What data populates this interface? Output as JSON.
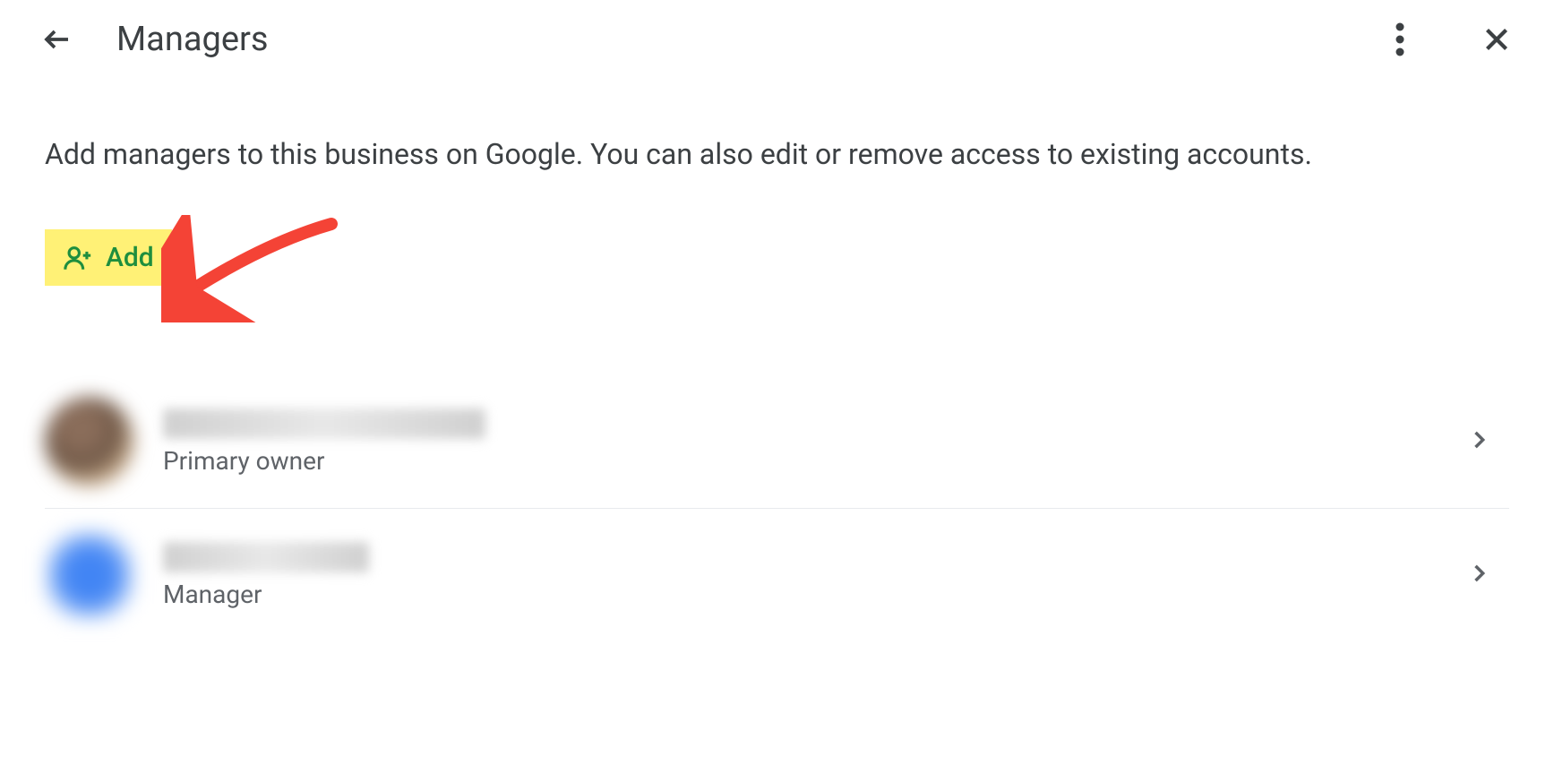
{
  "header": {
    "title": "Managers"
  },
  "content": {
    "description": "Add managers to this business on Google. You can also edit or remove access to existing accounts.",
    "add_button_label": "Add"
  },
  "managers": [
    {
      "role": "Primary owner"
    },
    {
      "role": "Manager"
    }
  ],
  "colors": {
    "highlight": "#fff176",
    "accent_green": "#1e8e3e",
    "arrow_red": "#f44336"
  }
}
